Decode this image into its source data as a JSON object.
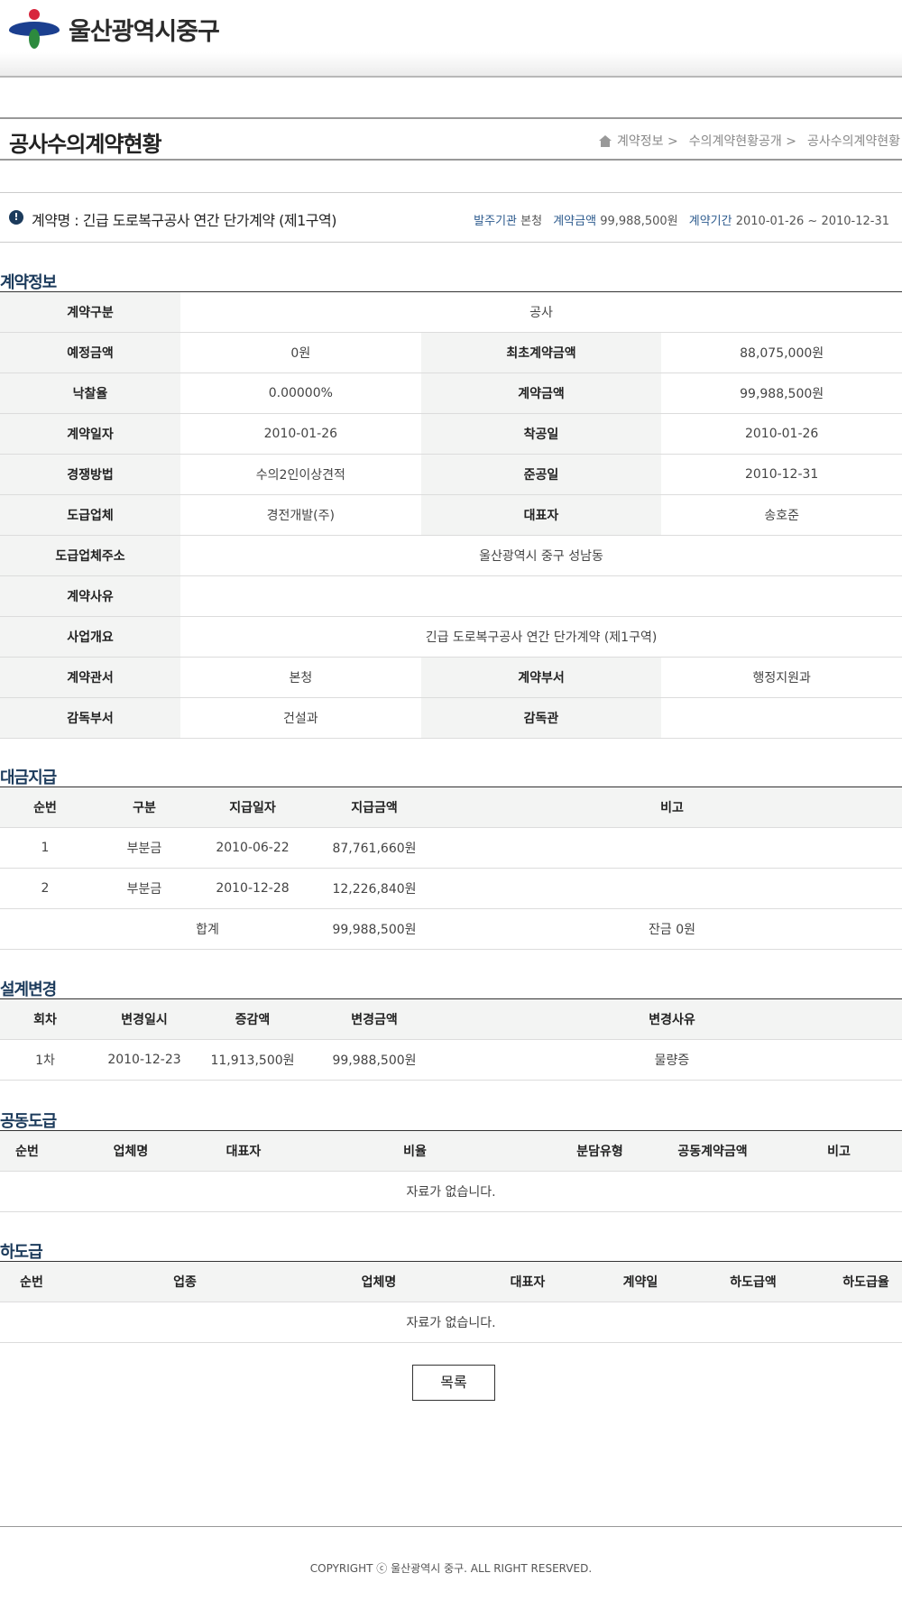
{
  "header": {
    "logo_text": "울산광역시중구"
  },
  "page": {
    "title": "공사수의계약현황",
    "breadcrumb": [
      "계약정보 >",
      "수의계약현황공개 >",
      "공사수의계약현황"
    ]
  },
  "contract": {
    "name": "계약명 : 긴급 도로복구공사 연간 단가계약 (제1구역)",
    "ordering_label": "발주기관",
    "ordering_value": "본청",
    "amount_label": "계약금액",
    "amount_value": "99,988,500원",
    "period_label": "계약기간",
    "period_value": "2010-01-26 ~ 2010-12-31"
  },
  "sections": {
    "info": "계약정보",
    "payment": "대금지급",
    "design_change": "설계변경",
    "joint": "공동도급",
    "subcontract": "하도급"
  },
  "info": {
    "contract_type_label": "계약구분",
    "contract_type": "공사",
    "est_amount_label": "예정금액",
    "est_amount": "0원",
    "initial_amount_label": "최초계약금액",
    "initial_amount": "88,075,000원",
    "bid_rate_label": "낙찰율",
    "bid_rate": "0.00000%",
    "contract_amount_label": "계약금액",
    "contract_amount": "99,988,500원",
    "contract_date_label": "계약일자",
    "contract_date": "2010-01-26",
    "start_date_label": "착공일",
    "start_date": "2010-01-26",
    "competition_label": "경쟁방법",
    "competition": "수의2인이상견적",
    "completion_label": "준공일",
    "completion": "2010-12-31",
    "contractor_label": "도급업체",
    "contractor": "경전개발(주)",
    "ceo_label": "대표자",
    "ceo": "송호준",
    "address_label": "도급업체주소",
    "address": "울산광역시 중구 성남동",
    "reason_label": "계약사유",
    "reason": "",
    "summary_label": "사업개요",
    "summary": "긴급 도로복구공사 연간 단가계약 (제1구역)",
    "office_label": "계약관서",
    "office": "본청",
    "dept_label": "계약부서",
    "dept": "행정지원과",
    "super_dept_label": "감독부서",
    "super_dept": "건설과",
    "supervisor_label": "감독관",
    "supervisor": ""
  },
  "payment": {
    "headers": [
      "순번",
      "구분",
      "지급일자",
      "지급금액",
      "비고"
    ],
    "rows": [
      [
        "1",
        "부분금",
        "2010-06-22",
        "87,761,660원",
        ""
      ],
      [
        "2",
        "부분금",
        "2010-12-28",
        "12,226,840원",
        ""
      ]
    ],
    "total_label": "합계",
    "total_amount": "99,988,500원",
    "balance": "잔금 0원"
  },
  "design_change": {
    "headers": [
      "회차",
      "변경일시",
      "증감액",
      "변경금액",
      "변경사유"
    ],
    "rows": [
      [
        "1차",
        "2010-12-23",
        "11,913,500원",
        "99,988,500원",
        "물량증"
      ]
    ]
  },
  "joint": {
    "headers": [
      "순번",
      "업체명",
      "대표자",
      "비율",
      "분담유형",
      "공동계약금액",
      "비고"
    ],
    "empty": "자료가 없습니다."
  },
  "subcontract": {
    "headers": [
      "순번",
      "업종",
      "업체명",
      "대표자",
      "계약일",
      "하도급액",
      "하도급율"
    ],
    "empty": "자료가 없습니다."
  },
  "buttons": {
    "list": "목록"
  },
  "footer": {
    "copyright": "COPYRIGHT ⓒ 울산광역시 중구. ALL RIGHT RESERVED."
  }
}
